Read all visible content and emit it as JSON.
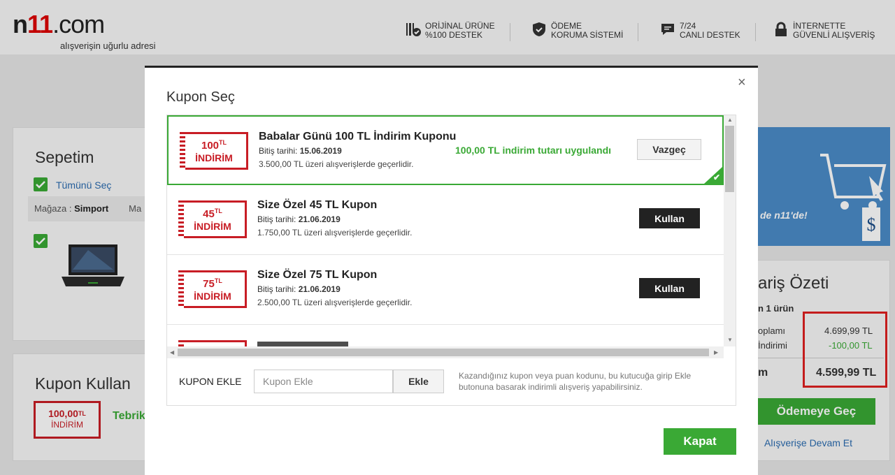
{
  "header": {
    "logo_prefix": "n",
    "logo_eleven": "11",
    "logo_suffix": ".com",
    "slogan": "alışverişin uğurlu adresi",
    "trust": [
      {
        "icon": "barcode-check-icon",
        "line1": "ORİJİNAL ÜRÜNE",
        "line2": "%100 DESTEK"
      },
      {
        "icon": "shield-check-icon",
        "line1": "ÖDEME",
        "line2": "KORUMA SİSTEMİ"
      },
      {
        "icon": "chat-icon",
        "line1": "7/24",
        "line2": "CANLI DESTEK"
      },
      {
        "icon": "lock-icon",
        "line1": "İNTERNETTE",
        "line2": "GÜVENLİ ALIŞVERİŞ"
      }
    ]
  },
  "cart": {
    "title": "Sepetim",
    "select_all": "Tümünü Seç",
    "store_label": "Mağaza :",
    "store_name": "Simport",
    "store_extra": "Ma"
  },
  "coupon_use": {
    "title": "Kupon Kullan",
    "amount": "100,00",
    "currency": "TL",
    "label": "İNDİRİM",
    "congrats": "Tebrik"
  },
  "summary": {
    "title_partial": "ariş Özeti",
    "items_partial": "n 1 ürün",
    "subtotal_label_partial": "oplamı",
    "subtotal_value": "4.699,99 TL",
    "discount_label_partial": "İndirimi",
    "discount_value": "-100,00 TL",
    "total_label_partial": "m",
    "total_value": "4.599,99 TL",
    "pay_button": "Ödemeye Geç",
    "continue_link": "Alışverişe Devam Et",
    "banner_text": "de n11'de!"
  },
  "modal": {
    "title": "Kupon Seç",
    "close": "×",
    "coupons": [
      {
        "amount": "100",
        "currency": "TL",
        "label": "İNDİRİM",
        "name": "Babalar Günü 100 TL İndirim Kuponu",
        "date_label": "Bitiş tarihi:",
        "date": "15.06.2019",
        "condition": "3.500,00 TL üzeri alışverişlerde geçerlidir.",
        "applied_text": "100,00 TL indirim tutarı uygulandı",
        "button": "Vazgeç"
      },
      {
        "amount": "45",
        "currency": "TL",
        "label": "İNDİRİM",
        "name": "Size Özel 45 TL Kupon",
        "date_label": "Bitiş tarihi:",
        "date": "21.06.2019",
        "condition": "1.750,00 TL üzeri alışverişlerde geçerlidir.",
        "button": "Kullan"
      },
      {
        "amount": "75",
        "currency": "TL",
        "label": "İNDİRİM",
        "name": "Size Özel 75 TL Kupon",
        "date_label": "Bitiş tarihi:",
        "date": "21.06.2019",
        "condition": "2.500,00 TL üzeri alışverişlerde geçerlidir.",
        "button": "Kullan"
      }
    ],
    "add": {
      "label": "KUPON EKLE",
      "placeholder": "Kupon Ekle",
      "button": "Ekle",
      "help": "Kazandığınız kupon veya puan kodunu, bu kutucuğa girip Ekle butonuna basarak indirimli alışveriş yapabilirsiniz."
    },
    "close_button": "Kapat"
  },
  "colors": {
    "brand_green": "#3aa935",
    "brand_red": "#c81d25",
    "highlight_red": "#e02020"
  }
}
